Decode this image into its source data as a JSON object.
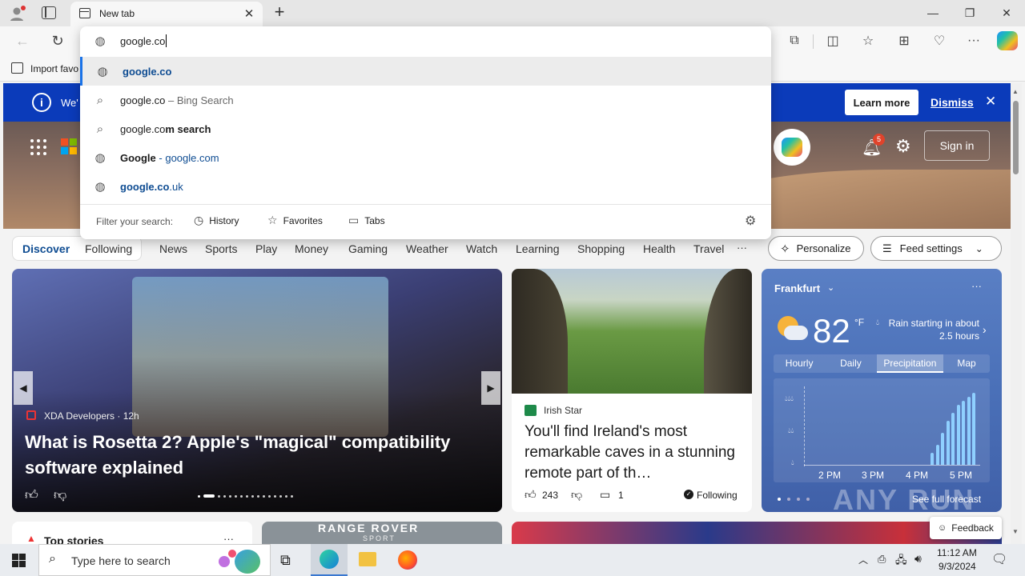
{
  "browser": {
    "tab_title": "New tab",
    "address_value": "google.co",
    "favorites_import": "Import favo",
    "window_buttons": [
      "minimize-icon",
      "restore-icon",
      "close-icon"
    ]
  },
  "omnibox": {
    "suggestions": [
      {
        "icon": "globe-icon",
        "main": "google.co",
        "rest": ""
      },
      {
        "icon": "search-icon",
        "main": "google.co",
        "rest": " – Bing Search"
      },
      {
        "icon": "search-icon",
        "main": "google.co",
        "rest": "m search"
      },
      {
        "icon": "globe-icon",
        "main": "Google",
        "rest": " - google.com"
      },
      {
        "icon": "globe-icon",
        "main": "google.co",
        "rest": ".uk"
      }
    ],
    "filter_label": "Filter your search:",
    "filters": [
      "History",
      "Favorites",
      "Tabs"
    ]
  },
  "banner": {
    "text": "We'",
    "learn_more": "Learn more",
    "dismiss": "Dismiss"
  },
  "hero": {
    "notification_count": "5",
    "sign_in": "Sign in"
  },
  "nav": {
    "discover": "Discover",
    "following": "Following",
    "items": [
      "News",
      "Sports",
      "Play",
      "Money",
      "Gaming",
      "Weather",
      "Watch",
      "Learning",
      "Shopping",
      "Health",
      "Travel"
    ],
    "more": "···",
    "personalize": "Personalize",
    "feed_settings": "Feed settings"
  },
  "main_card": {
    "source": "XDA Developers · 12h",
    "title": "What is Rosetta 2? Apple's \"magical\" compatibility software explained"
  },
  "side_card": {
    "source": "Irish Star",
    "title": "You'll find Ireland's most remarkable caves in a stunning remote part of th…",
    "likes": "243",
    "comments": "1",
    "following": "Following"
  },
  "weather": {
    "city": "Frankfurt",
    "temp": "82",
    "unit": "°F",
    "rain_msg": "Rain starting in about 2.5 hours",
    "tabs": [
      "Hourly",
      "Daily",
      "Precipitation",
      "Map"
    ],
    "times": [
      "2 PM",
      "3 PM",
      "4 PM",
      "5 PM"
    ],
    "see_full": "See full forecast",
    "precip_levels": [
      0.15,
      0.25,
      0.4,
      0.55,
      0.65,
      0.75,
      0.8,
      0.85,
      0.9
    ]
  },
  "bottom": {
    "top_stories": "Top stories",
    "range_rover": "RANGE ROVER",
    "range_rover_sub": "SPORT",
    "feedback": "Feedback"
  },
  "taskbar": {
    "search_placeholder": "Type here to search",
    "time": "11:12 AM",
    "date": "9/3/2024"
  },
  "watermark": "ANY RUN"
}
